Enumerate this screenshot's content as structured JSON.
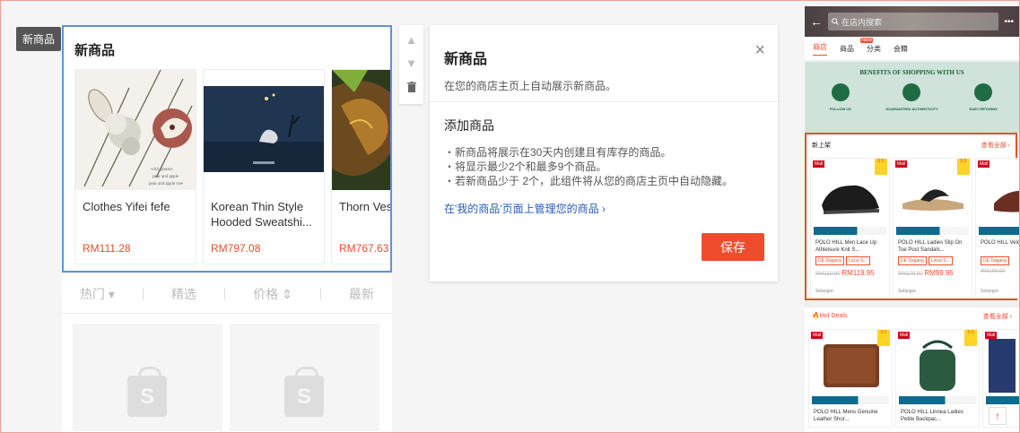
{
  "tag_label": "新商品",
  "widget": {
    "title": "新商品",
    "products": [
      {
        "name": "Clothes Yifei fefe",
        "price": "RM111.28",
        "img_caption_1": "wild grasses",
        "img_caption_2": "pear and apple",
        "img_caption_3": "pear and apple tree"
      },
      {
        "name": "Korean Thin Style Hooded Sweatshi...",
        "price": "RM797.08"
      },
      {
        "name": "Thorn Ves",
        "price": "RM767.63"
      }
    ]
  },
  "tools": {
    "up": "▲",
    "down": "▼",
    "delete": "🗑"
  },
  "sort_tabs": {
    "popular": "热门",
    "popular_arrow": "▾",
    "selected": "精选",
    "price": "价格",
    "price_arrow": "⇕",
    "latest": "最新"
  },
  "panel": {
    "title": "新商品",
    "subtitle": "在您的商店主页上自动展示新商品。",
    "close": "×",
    "add_heading": "添加商品",
    "rules": [
      "・新商品将展示在30天内创建且有库存的商品。",
      "・将显示最少2个和最多9个商品。",
      "・若新商品少于 2个，此组件将从您的商店主页中自动隐藏。"
    ],
    "manage_link": "在'我的商品'页面上管理您的商品",
    "manage_arrow": "›",
    "save": "保存"
  },
  "phone": {
    "back": "←",
    "search_placeholder": "在店内搜索",
    "more": "•••",
    "tabs": [
      "商店",
      "商品",
      "分类",
      "会籍"
    ],
    "new_badge": "New",
    "benefits_title": "BENEFITS OF SHOPPING WITH US",
    "benefits": [
      "FOLLOW US",
      "GUARANTEED AUTHENTICITY",
      "EASY RETURNS"
    ],
    "new_section": {
      "title": "新上架",
      "view_all": "查看全部 ›"
    },
    "new_products": [
      {
        "name": "POLO HILL Men Lace Up Athleisure Knit S...",
        "chips": [
          "DE Dagang",
          "Local S..."
        ],
        "old_price": "RM219.90",
        "price": "RM119.95",
        "loc": "Selangor",
        "mall": "Mall",
        "disc": "5.5"
      },
      {
        "name": "POLO HILL Ladies Slip On Toe Post Sandals...",
        "chips": [
          "DE Dagang",
          "Local S..."
        ],
        "old_price": "RM179.90",
        "price": "RM99.95",
        "loc": "Selangor",
        "mall": "Mall",
        "disc": "5.5"
      },
      {
        "name": "POLO HILL Velcro Antis...",
        "chips": [
          "DE Dagang"
        ],
        "old_price": "RM199.90",
        "price": "",
        "loc": "Selangor",
        "mall": "Mall",
        "disc": ""
      }
    ],
    "hot_section": {
      "title": "Hot Deals",
      "view_all": "查看全部 ›"
    },
    "hot_products": [
      {
        "name": "POLO HILL Mens Genuine Leather Shor...",
        "mall": "Mall",
        "disc": "5.5"
      },
      {
        "name": "POLO HILL Linnea Ladies Petite Backpac...",
        "mall": "Mall",
        "disc": "5.5"
      },
      {
        "name": "",
        "mall": "Mall",
        "disc": ""
      }
    ],
    "to_top": "↑"
  }
}
